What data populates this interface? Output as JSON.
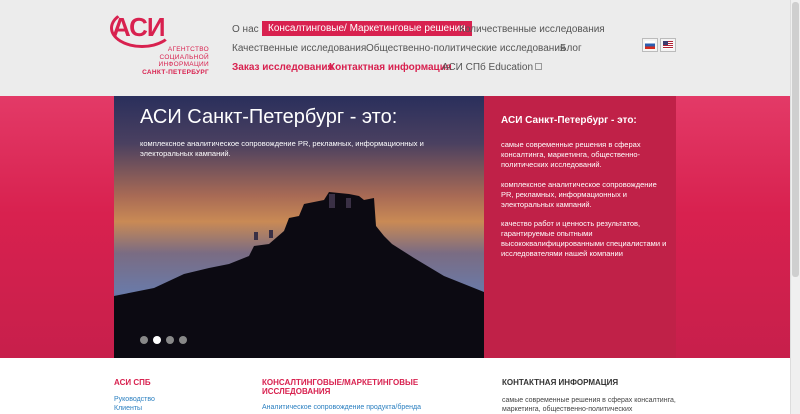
{
  "logo": {
    "mark": "АСИ",
    "lines": [
      "АГЕНТСТВО",
      "СОЦИАЛЬНОЙ",
      "ИНФОРМАЦИИ"
    ],
    "city": "САНКТ-ПЕТЕРБУРГ"
  },
  "nav": {
    "about": "О нас",
    "consulting": "Консалтинговые/ Маркетинговые решения",
    "quantitative": "Количественные исследования",
    "qualitative": "Качественные исследования",
    "political": "Общественно-политические исследования",
    "blog": "Блог",
    "order": "Заказ исследования",
    "contacts": "Контактная информация",
    "education": "АСИ СПб Education"
  },
  "slider": {
    "title": "АСИ Санкт-Петербург - это:",
    "text": "комплексное аналитическое сопровождение PR, рекламных, информационных и электоральных кампаний."
  },
  "panel": {
    "title": "АСИ Санкт-Петербург - это:",
    "p1": "самые современные решения в сферах консалтинга, маркетинга, общественно-политических исследований.",
    "p2": "комплексное аналитическое сопровождение PR, рекламных, информационных и электоральных кампаний.",
    "p3": "качество работ и ценность результатов, гарантируемые опытными высококвалифицированными специалистами и исследователями нашей компании"
  },
  "footer": {
    "col1_title": "АСИ СПБ",
    "col1_link1": "Руководство",
    "col1_link2": "Клиенты",
    "col2_title_line1": "КОНСАЛТИНГОВЫЕ/МАРКЕТИНГОВЫЕ",
    "col2_title_line2": "ИССЛЕДОВАНИЯ",
    "col2_link1": "Аналитическое сопровождение продукта/бренда",
    "col3_title": "КОНТАКТНАЯ ИНФОРМАЦИЯ",
    "col3_text": "самые современные решения в сферах консалтинга, маркетинга, общественно-политических исследований."
  },
  "colors": {
    "accent": "#d8214f",
    "panel": "#c02148",
    "link": "#2a7fc0"
  },
  "icons": {
    "ru_flag": "ru-flag-icon",
    "en_flag": "en-flag-icon",
    "external": "external-link-icon"
  }
}
